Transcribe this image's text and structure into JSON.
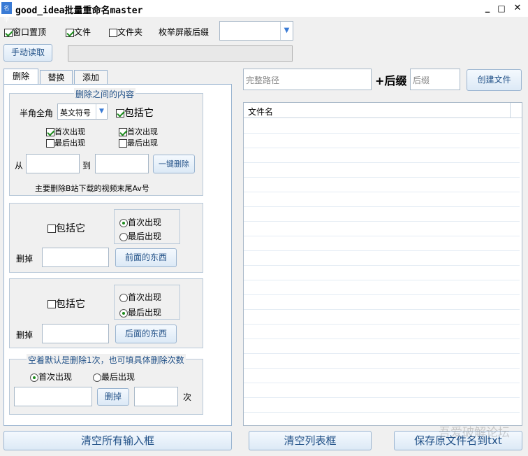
{
  "window": {
    "title": "good_idea批量重命名master",
    "icon": "app-icon",
    "min": "_",
    "max": "□",
    "close": "✕"
  },
  "topbar": {
    "stay_on_top": {
      "label": "窗口置顶",
      "checked": true
    },
    "file": {
      "label": "文件",
      "checked": true
    },
    "folder": {
      "label": "文件夹",
      "checked": false
    },
    "suffix_label": "枚举屏蔽后缀",
    "suffix_value": "",
    "manual_read": "手动读取",
    "path_value": ""
  },
  "tabs": [
    "删除",
    "替换",
    "添加"
  ],
  "between": {
    "legend": "删除之间的内容",
    "width_label": "半角全角",
    "width_value": "英文符号",
    "include": {
      "label": "包括它",
      "checked": true
    },
    "first_a": {
      "label": "首次出现",
      "checked": true
    },
    "last_a": {
      "label": "最后出现",
      "checked": false
    },
    "first_b": {
      "label": "首次出现",
      "checked": true
    },
    "last_b": {
      "label": "最后出现",
      "checked": false
    },
    "from_label": "从",
    "to_label": "到",
    "from_value": "",
    "to_value": "",
    "one_click": "一键删除",
    "note": "主要删除B站下载的视频末尾Av号"
  },
  "front": {
    "include": {
      "label": "包括它",
      "checked": false
    },
    "first": {
      "label": "首次出现",
      "checked": true
    },
    "last": {
      "label": "最后出现",
      "checked": false
    },
    "delete_label": "删掉",
    "value": "",
    "button": "前面的东西"
  },
  "back": {
    "include": {
      "label": "包括它",
      "checked": false
    },
    "first": {
      "label": "首次出现",
      "checked": false
    },
    "last": {
      "label": "最后出现",
      "checked": true
    },
    "delete_label": "删掉",
    "value": "",
    "button": "后面的东西"
  },
  "count": {
    "legend": "空着默认是删除1次，也可填具体删除次数",
    "first": {
      "label": "首次出现",
      "checked": true
    },
    "last": {
      "label": "最后出现",
      "checked": false
    },
    "value": "",
    "delete_button": "删掉",
    "times_value": "",
    "times_label": "次"
  },
  "create": {
    "path_placeholder": "完整路径",
    "plus_suffix": "+后缀",
    "suffix_placeholder": "后缀",
    "button": "创建文件"
  },
  "list": {
    "column": "文件名",
    "rows": []
  },
  "bottom": {
    "clear_inputs": "清空所有输入框",
    "clear_list": "清空列表框",
    "save_txt": "保存原文件名到txt"
  },
  "watermark": "吾爱破解论坛",
  "colors": {
    "accent": "#1f4f86",
    "check": "#1a8a1a"
  }
}
